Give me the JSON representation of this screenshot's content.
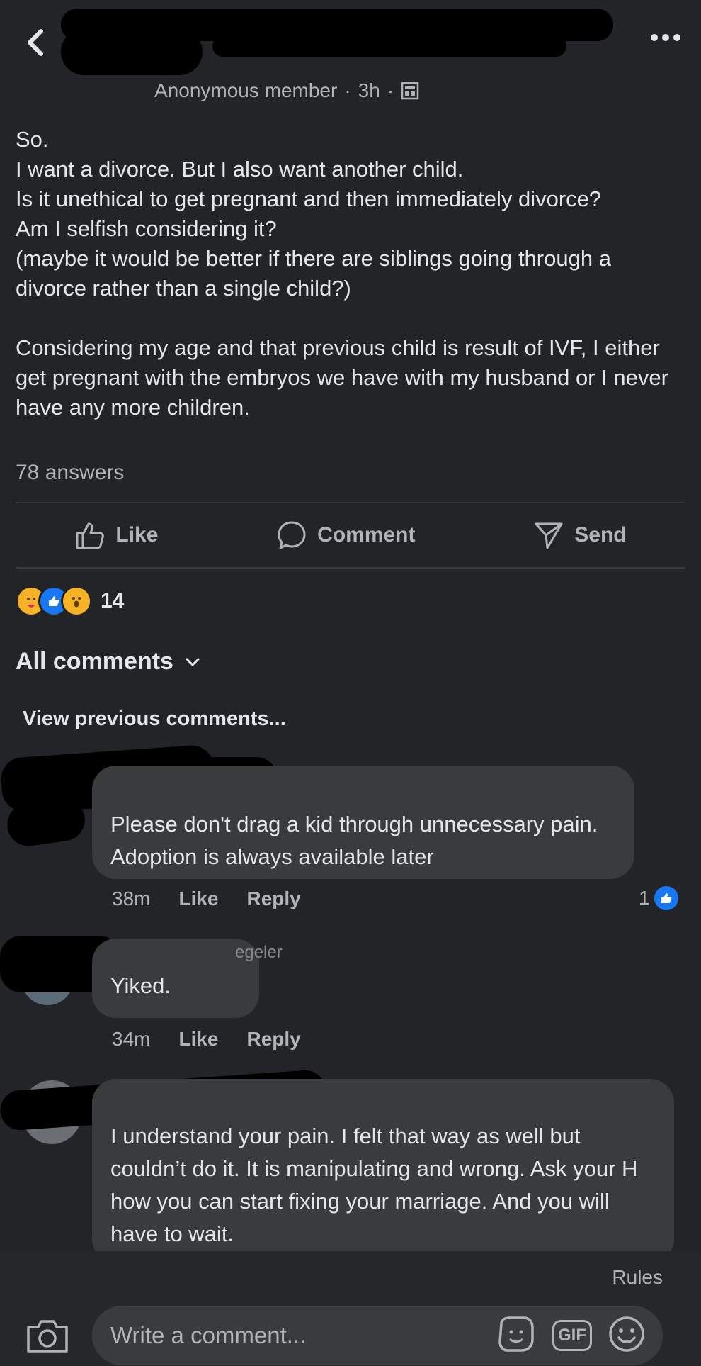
{
  "header": {
    "author": "Anonymous member",
    "time": "3h",
    "separator": "·"
  },
  "post": {
    "lines": [
      "So.",
      "I want a divorce. But I also want another child.",
      "Is it unethical to get pregnant and then immediately divorce?",
      "Am I selfish considering it?",
      "(maybe it would be better if there are siblings going through a divorce rather than a single child?)"
    ],
    "paragraph2": "Considering my age and that previous child is result of IVF, I either get pregnant with the embryos we have with my husband or I never have any more children.",
    "answers": "78 answers"
  },
  "actions": {
    "like": "Like",
    "comment": "Comment",
    "send": "Send"
  },
  "reactions": {
    "count": "14",
    "colors": [
      "#f7b125",
      "#1877f2",
      "#f7b125"
    ]
  },
  "comments_header": {
    "filter": "All comments",
    "view_previous": "View previous comments..."
  },
  "comments": [
    {
      "text": "Please don't drag a kid through unnecessary pain. Adoption is always available later",
      "time": "38m",
      "like": "Like",
      "reply": "Reply",
      "like_count": "1"
    },
    {
      "name_partial": "egeler",
      "text": "Yiked.",
      "time": "34m",
      "like": "Like",
      "reply": "Reply"
    },
    {
      "text": "I understand your pain. I felt that way as well but couldn’t do it. It is manipulating and wrong. Ask your H how you can start fixing your marriage. And you will have to wait."
    }
  ],
  "footer": {
    "rules": "Rules",
    "placeholder": "Write a comment...",
    "gif": "GIF"
  },
  "accent": "#1877f2"
}
